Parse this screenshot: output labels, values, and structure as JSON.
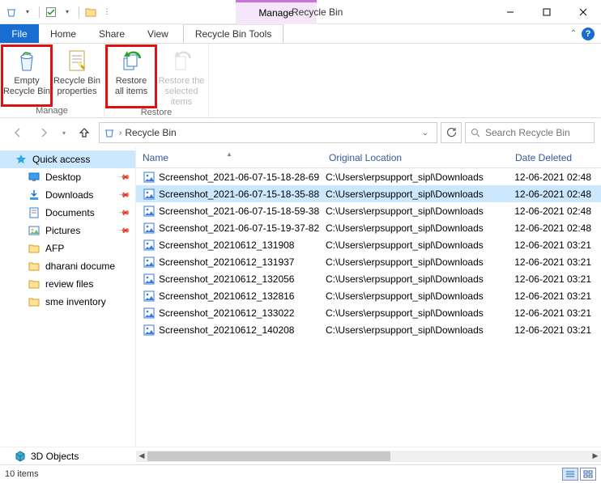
{
  "window": {
    "title": "Recycle Bin",
    "manage_label": "Manage"
  },
  "tabs": {
    "file": "File",
    "home": "Home",
    "share": "Share",
    "view": "View",
    "context": "Recycle Bin Tools"
  },
  "ribbon": {
    "empty": {
      "l1": "Empty",
      "l2": "Recycle Bin"
    },
    "props": {
      "l1": "Recycle Bin",
      "l2": "properties"
    },
    "restore_all": {
      "l1": "Restore",
      "l2": "all items"
    },
    "restore_sel": {
      "l1": "Restore the",
      "l2": "selected items"
    },
    "group_manage": "Manage",
    "group_restore": "Restore"
  },
  "nav": {
    "location": "Recycle Bin",
    "search_placeholder": "Search Recycle Bin"
  },
  "sidebar": {
    "quick": "Quick access",
    "items": [
      {
        "label": "Desktop",
        "pinned": true
      },
      {
        "label": "Downloads",
        "pinned": true
      },
      {
        "label": "Documents",
        "pinned": true
      },
      {
        "label": "Pictures",
        "pinned": true
      },
      {
        "label": "AFP",
        "pinned": false
      },
      {
        "label": "dharani docume",
        "pinned": false
      },
      {
        "label": "review files",
        "pinned": false
      },
      {
        "label": "sme inventory",
        "pinned": false
      }
    ],
    "threeD": "3D Objects"
  },
  "columns": {
    "name": "Name",
    "loc": "Original Location",
    "date": "Date Deleted"
  },
  "files": [
    {
      "name": "Screenshot_2021-06-07-15-18-28-69",
      "loc": "C:\\Users\\erpsupport_sipl\\Downloads",
      "date": "12-06-2021 02:48",
      "selected": false
    },
    {
      "name": "Screenshot_2021-06-07-15-18-35-88",
      "loc": "C:\\Users\\erpsupport_sipl\\Downloads",
      "date": "12-06-2021 02:48",
      "selected": true
    },
    {
      "name": "Screenshot_2021-06-07-15-18-59-38",
      "loc": "C:\\Users\\erpsupport_sipl\\Downloads",
      "date": "12-06-2021 02:48",
      "selected": false
    },
    {
      "name": "Screenshot_2021-06-07-15-19-37-82",
      "loc": "C:\\Users\\erpsupport_sipl\\Downloads",
      "date": "12-06-2021 02:48",
      "selected": false
    },
    {
      "name": "Screenshot_20210612_131908",
      "loc": "C:\\Users\\erpsupport_sipl\\Downloads",
      "date": "12-06-2021 03:21",
      "selected": false
    },
    {
      "name": "Screenshot_20210612_131937",
      "loc": "C:\\Users\\erpsupport_sipl\\Downloads",
      "date": "12-06-2021 03:21",
      "selected": false
    },
    {
      "name": "Screenshot_20210612_132056",
      "loc": "C:\\Users\\erpsupport_sipl\\Downloads",
      "date": "12-06-2021 03:21",
      "selected": false
    },
    {
      "name": "Screenshot_20210612_132816",
      "loc": "C:\\Users\\erpsupport_sipl\\Downloads",
      "date": "12-06-2021 03:21",
      "selected": false
    },
    {
      "name": "Screenshot_20210612_133022",
      "loc": "C:\\Users\\erpsupport_sipl\\Downloads",
      "date": "12-06-2021 03:21",
      "selected": false
    },
    {
      "name": "Screenshot_20210612_140208",
      "loc": "C:\\Users\\erpsupport_sipl\\Downloads",
      "date": "12-06-2021 03:21",
      "selected": false
    }
  ],
  "status": {
    "count": "10 items"
  }
}
